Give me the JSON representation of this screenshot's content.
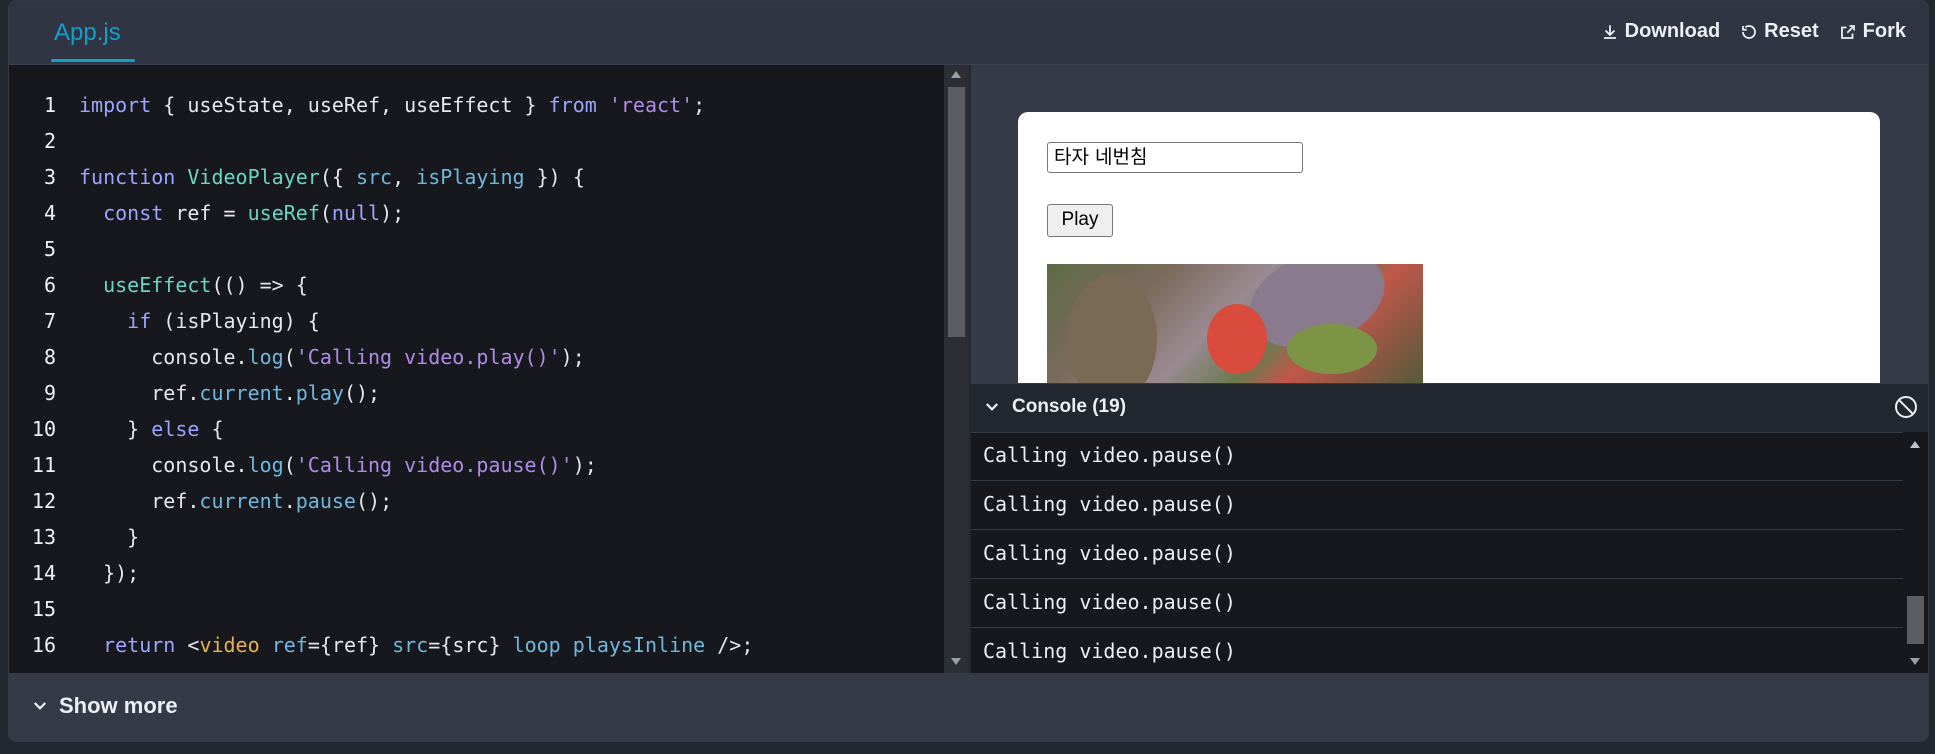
{
  "tabs": [
    {
      "label": "App.js"
    }
  ],
  "actions": {
    "download": "Download",
    "reset": "Reset",
    "fork": "Fork"
  },
  "code": {
    "lines": [
      {
        "n": "1"
      },
      {
        "n": "2"
      },
      {
        "n": "3"
      },
      {
        "n": "4"
      },
      {
        "n": "5"
      },
      {
        "n": "6"
      },
      {
        "n": "7"
      },
      {
        "n": "8"
      },
      {
        "n": "9"
      },
      {
        "n": "10"
      },
      {
        "n": "11"
      },
      {
        "n": "12"
      },
      {
        "n": "13"
      },
      {
        "n": "14"
      },
      {
        "n": "15"
      },
      {
        "n": "16"
      }
    ],
    "tokens": {
      "l1": [
        "import",
        " { useState, useRef, useEffect } ",
        "from",
        " ",
        "'react'",
        ";"
      ],
      "l3": [
        "function",
        " ",
        "VideoPlayer",
        "({ ",
        "src",
        ", ",
        "isPlaying",
        " }) {"
      ],
      "l4": [
        "  ",
        "const",
        " ref = ",
        "useRef",
        "(",
        "null",
        ");"
      ],
      "l6": [
        "  ",
        "useEffect",
        "(() => {"
      ],
      "l7": [
        "    ",
        "if",
        " (isPlaying) {"
      ],
      "l8": [
        "      console.",
        "log",
        "(",
        "'Calling video.play()'",
        ");"
      ],
      "l9": [
        "      ref.",
        "current",
        ".",
        "play",
        "();"
      ],
      "l10": [
        "    } ",
        "else",
        " {"
      ],
      "l11": [
        "      console.",
        "log",
        "(",
        "'Calling video.pause()'",
        ");"
      ],
      "l12": [
        "      ref.",
        "current",
        ".",
        "pause",
        "();"
      ],
      "l13": [
        "    }"
      ],
      "l14": [
        "  });"
      ],
      "l16": [
        "  ",
        "return",
        " <",
        "video",
        " ",
        "ref",
        "={ref} ",
        "src",
        "={src} ",
        "loop",
        " ",
        "playsInline",
        " />;"
      ]
    }
  },
  "preview": {
    "text_input_value": "타자 네번침",
    "play_button": "Play"
  },
  "console": {
    "title": "Console (19)",
    "entries": [
      "Calling video.pause()",
      "Calling video.pause()",
      "Calling video.pause()",
      "Calling video.pause()",
      "Calling video.pause()"
    ]
  },
  "footer": {
    "show_more": "Show more"
  },
  "colors": {
    "accent": "#149eca",
    "editor_bg": "#16181d",
    "chrome_bg": "#2f3542"
  }
}
